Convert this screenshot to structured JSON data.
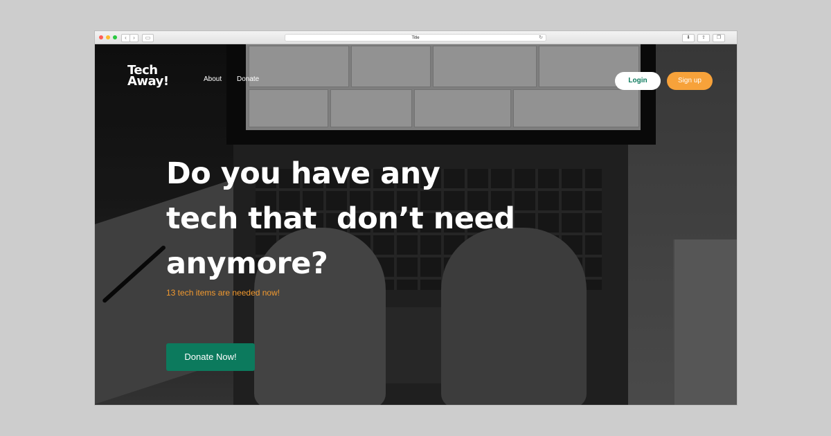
{
  "window": {
    "title": "Title"
  },
  "browser_icons": {
    "back": "chevron-left-icon",
    "forward": "chevron-right-icon",
    "sidebar": "sidebar-icon",
    "reload": "reload-icon",
    "download": "download-icon",
    "share": "share-icon",
    "tabs": "tabs-icon",
    "new_tab": "plus-icon"
  },
  "header": {
    "logo_line1": "Tech",
    "logo_line2": "Away!",
    "nav": [
      "About",
      "Donate"
    ],
    "login_label": "Login",
    "signup_label": "Sign up"
  },
  "hero": {
    "headline_line1": "Do you have any",
    "headline_line2": "tech that  don’t need",
    "headline_line3": "anymore?",
    "subtext": "13 tech items are needed now!",
    "cta_label": "Donate Now!"
  },
  "colors": {
    "accent_green": "#0c7a5d",
    "accent_orange": "#f7a23a"
  }
}
